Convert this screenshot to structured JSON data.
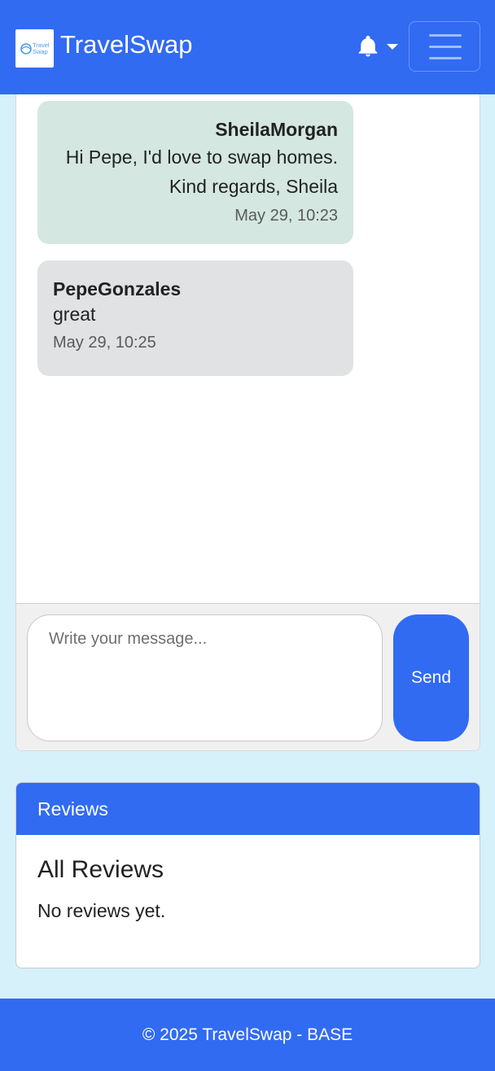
{
  "navbar": {
    "brand_name": "TravelSwap",
    "logo_text_line1": "Travel",
    "logo_text_line2": "Swap",
    "notification_icon": "bell-icon",
    "menu_icon": "hamburger-icon"
  },
  "chat": {
    "messages": [
      {
        "author": "SheilaMorgan",
        "text": "Hi Pepe, I'd love to swap homes. Kind regards, Sheila",
        "time": "May 29, 10:23",
        "direction": "sent"
      },
      {
        "author": "PepeGonzales",
        "text": "great",
        "time": "May 29, 10:25",
        "direction": "received"
      }
    ],
    "input_placeholder": "Write your message...",
    "input_value": "",
    "send_label": "Send"
  },
  "reviews": {
    "header": "Reviews",
    "title": "All Reviews",
    "empty_text": "No reviews yet."
  },
  "footer": {
    "text": "© 2025 TravelSwap - BASE"
  },
  "colors": {
    "primary": "#316bf2",
    "page_background": "#d6f1fa",
    "sent_bubble": "#d4e7e0",
    "received_bubble": "#e1e2e4"
  }
}
